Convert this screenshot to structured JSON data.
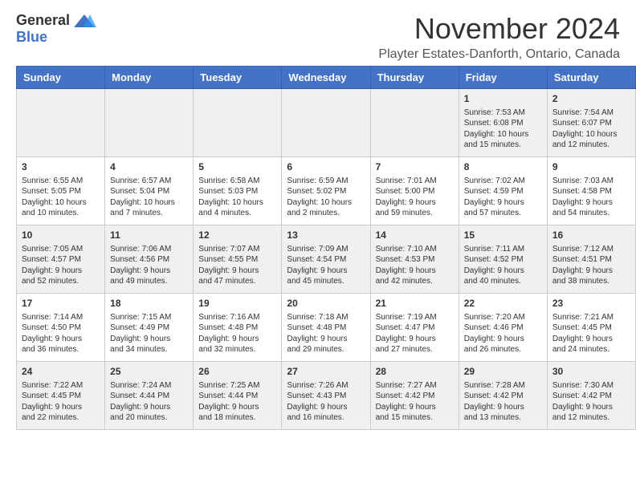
{
  "logo": {
    "general": "General",
    "blue": "Blue"
  },
  "title": "November 2024",
  "location": "Playter Estates-Danforth, Ontario, Canada",
  "days": [
    "Sunday",
    "Monday",
    "Tuesday",
    "Wednesday",
    "Thursday",
    "Friday",
    "Saturday"
  ],
  "weeks": [
    [
      {
        "day": "",
        "info": ""
      },
      {
        "day": "",
        "info": ""
      },
      {
        "day": "",
        "info": ""
      },
      {
        "day": "",
        "info": ""
      },
      {
        "day": "",
        "info": ""
      },
      {
        "day": "1",
        "info": "Sunrise: 7:53 AM\nSunset: 6:08 PM\nDaylight: 10 hours\nand 15 minutes."
      },
      {
        "day": "2",
        "info": "Sunrise: 7:54 AM\nSunset: 6:07 PM\nDaylight: 10 hours\nand 12 minutes."
      }
    ],
    [
      {
        "day": "3",
        "info": "Sunrise: 6:55 AM\nSunset: 5:05 PM\nDaylight: 10 hours\nand 10 minutes."
      },
      {
        "day": "4",
        "info": "Sunrise: 6:57 AM\nSunset: 5:04 PM\nDaylight: 10 hours\nand 7 minutes."
      },
      {
        "day": "5",
        "info": "Sunrise: 6:58 AM\nSunset: 5:03 PM\nDaylight: 10 hours\nand 4 minutes."
      },
      {
        "day": "6",
        "info": "Sunrise: 6:59 AM\nSunset: 5:02 PM\nDaylight: 10 hours\nand 2 minutes."
      },
      {
        "day": "7",
        "info": "Sunrise: 7:01 AM\nSunset: 5:00 PM\nDaylight: 9 hours\nand 59 minutes."
      },
      {
        "day": "8",
        "info": "Sunrise: 7:02 AM\nSunset: 4:59 PM\nDaylight: 9 hours\nand 57 minutes."
      },
      {
        "day": "9",
        "info": "Sunrise: 7:03 AM\nSunset: 4:58 PM\nDaylight: 9 hours\nand 54 minutes."
      }
    ],
    [
      {
        "day": "10",
        "info": "Sunrise: 7:05 AM\nSunset: 4:57 PM\nDaylight: 9 hours\nand 52 minutes."
      },
      {
        "day": "11",
        "info": "Sunrise: 7:06 AM\nSunset: 4:56 PM\nDaylight: 9 hours\nand 49 minutes."
      },
      {
        "day": "12",
        "info": "Sunrise: 7:07 AM\nSunset: 4:55 PM\nDaylight: 9 hours\nand 47 minutes."
      },
      {
        "day": "13",
        "info": "Sunrise: 7:09 AM\nSunset: 4:54 PM\nDaylight: 9 hours\nand 45 minutes."
      },
      {
        "day": "14",
        "info": "Sunrise: 7:10 AM\nSunset: 4:53 PM\nDaylight: 9 hours\nand 42 minutes."
      },
      {
        "day": "15",
        "info": "Sunrise: 7:11 AM\nSunset: 4:52 PM\nDaylight: 9 hours\nand 40 minutes."
      },
      {
        "day": "16",
        "info": "Sunrise: 7:12 AM\nSunset: 4:51 PM\nDaylight: 9 hours\nand 38 minutes."
      }
    ],
    [
      {
        "day": "17",
        "info": "Sunrise: 7:14 AM\nSunset: 4:50 PM\nDaylight: 9 hours\nand 36 minutes."
      },
      {
        "day": "18",
        "info": "Sunrise: 7:15 AM\nSunset: 4:49 PM\nDaylight: 9 hours\nand 34 minutes."
      },
      {
        "day": "19",
        "info": "Sunrise: 7:16 AM\nSunset: 4:48 PM\nDaylight: 9 hours\nand 32 minutes."
      },
      {
        "day": "20",
        "info": "Sunrise: 7:18 AM\nSunset: 4:48 PM\nDaylight: 9 hours\nand 29 minutes."
      },
      {
        "day": "21",
        "info": "Sunrise: 7:19 AM\nSunset: 4:47 PM\nDaylight: 9 hours\nand 27 minutes."
      },
      {
        "day": "22",
        "info": "Sunrise: 7:20 AM\nSunset: 4:46 PM\nDaylight: 9 hours\nand 26 minutes."
      },
      {
        "day": "23",
        "info": "Sunrise: 7:21 AM\nSunset: 4:45 PM\nDaylight: 9 hours\nand 24 minutes."
      }
    ],
    [
      {
        "day": "24",
        "info": "Sunrise: 7:22 AM\nSunset: 4:45 PM\nDaylight: 9 hours\nand 22 minutes."
      },
      {
        "day": "25",
        "info": "Sunrise: 7:24 AM\nSunset: 4:44 PM\nDaylight: 9 hours\nand 20 minutes."
      },
      {
        "day": "26",
        "info": "Sunrise: 7:25 AM\nSunset: 4:44 PM\nDaylight: 9 hours\nand 18 minutes."
      },
      {
        "day": "27",
        "info": "Sunrise: 7:26 AM\nSunset: 4:43 PM\nDaylight: 9 hours\nand 16 minutes."
      },
      {
        "day": "28",
        "info": "Sunrise: 7:27 AM\nSunset: 4:42 PM\nDaylight: 9 hours\nand 15 minutes."
      },
      {
        "day": "29",
        "info": "Sunrise: 7:28 AM\nSunset: 4:42 PM\nDaylight: 9 hours\nand 13 minutes."
      },
      {
        "day": "30",
        "info": "Sunrise: 7:30 AM\nSunset: 4:42 PM\nDaylight: 9 hours\nand 12 minutes."
      }
    ]
  ]
}
